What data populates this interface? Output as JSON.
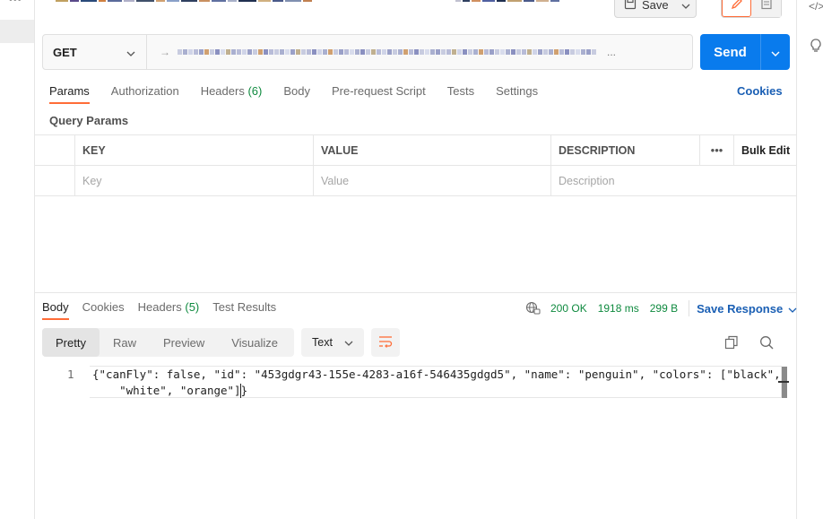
{
  "header": {
    "save_label": "Save"
  },
  "request": {
    "method": "GET",
    "url_obscured": "https://...",
    "send_label": "Send",
    "tabs": [
      {
        "label": "Params",
        "count": "",
        "active": true
      },
      {
        "label": "Authorization",
        "count": "",
        "active": false
      },
      {
        "label": "Headers",
        "count": "(6)",
        "active": false
      },
      {
        "label": "Body",
        "count": "",
        "active": false
      },
      {
        "label": "Pre-request Script",
        "count": "",
        "active": false
      },
      {
        "label": "Tests",
        "count": "",
        "active": false
      },
      {
        "label": "Settings",
        "count": "",
        "active": false
      }
    ],
    "cookies_label": "Cookies",
    "query_params_title": "Query Params",
    "params_table": {
      "headers": [
        "KEY",
        "VALUE",
        "DESCRIPTION"
      ],
      "bulk_edit_label": "Bulk Edit",
      "placeholders": [
        "Key",
        "Value",
        "Description"
      ]
    }
  },
  "response": {
    "tabs": [
      {
        "label": "Body",
        "count": "",
        "active": true
      },
      {
        "label": "Cookies",
        "count": "",
        "active": false
      },
      {
        "label": "Headers",
        "count": "(5)",
        "active": false
      },
      {
        "label": "Test Results",
        "count": "",
        "active": false
      }
    ],
    "status": "200 OK",
    "time": "1918 ms",
    "size": "299 B",
    "save_response_label": "Save Response",
    "views": [
      "Pretty",
      "Raw",
      "Preview",
      "Visualize"
    ],
    "active_view": "Pretty",
    "format": "Text",
    "line_number": "1",
    "body": "{\"canFly\": false, \"id\": \"453gdgr43-155e-4283-a16f-546435gdgd5\", \"name\": \"penguin\", \"colors\": [\"black\",\n    \"white\", \"orange\"]}"
  },
  "colors": {
    "accent": "#ff6c37",
    "send_button": "#097bed",
    "link": "#1a5fb4",
    "success": "#0f8a3f"
  },
  "icons": [
    "more-dots-icon",
    "save-icon",
    "chevron-down-icon",
    "edit-icon",
    "document-icon",
    "url-arrow-icon",
    "globe-lock-icon",
    "wrap-lines-icon",
    "copy-icon",
    "search-icon",
    "code-icon",
    "lightbulb-icon"
  ]
}
